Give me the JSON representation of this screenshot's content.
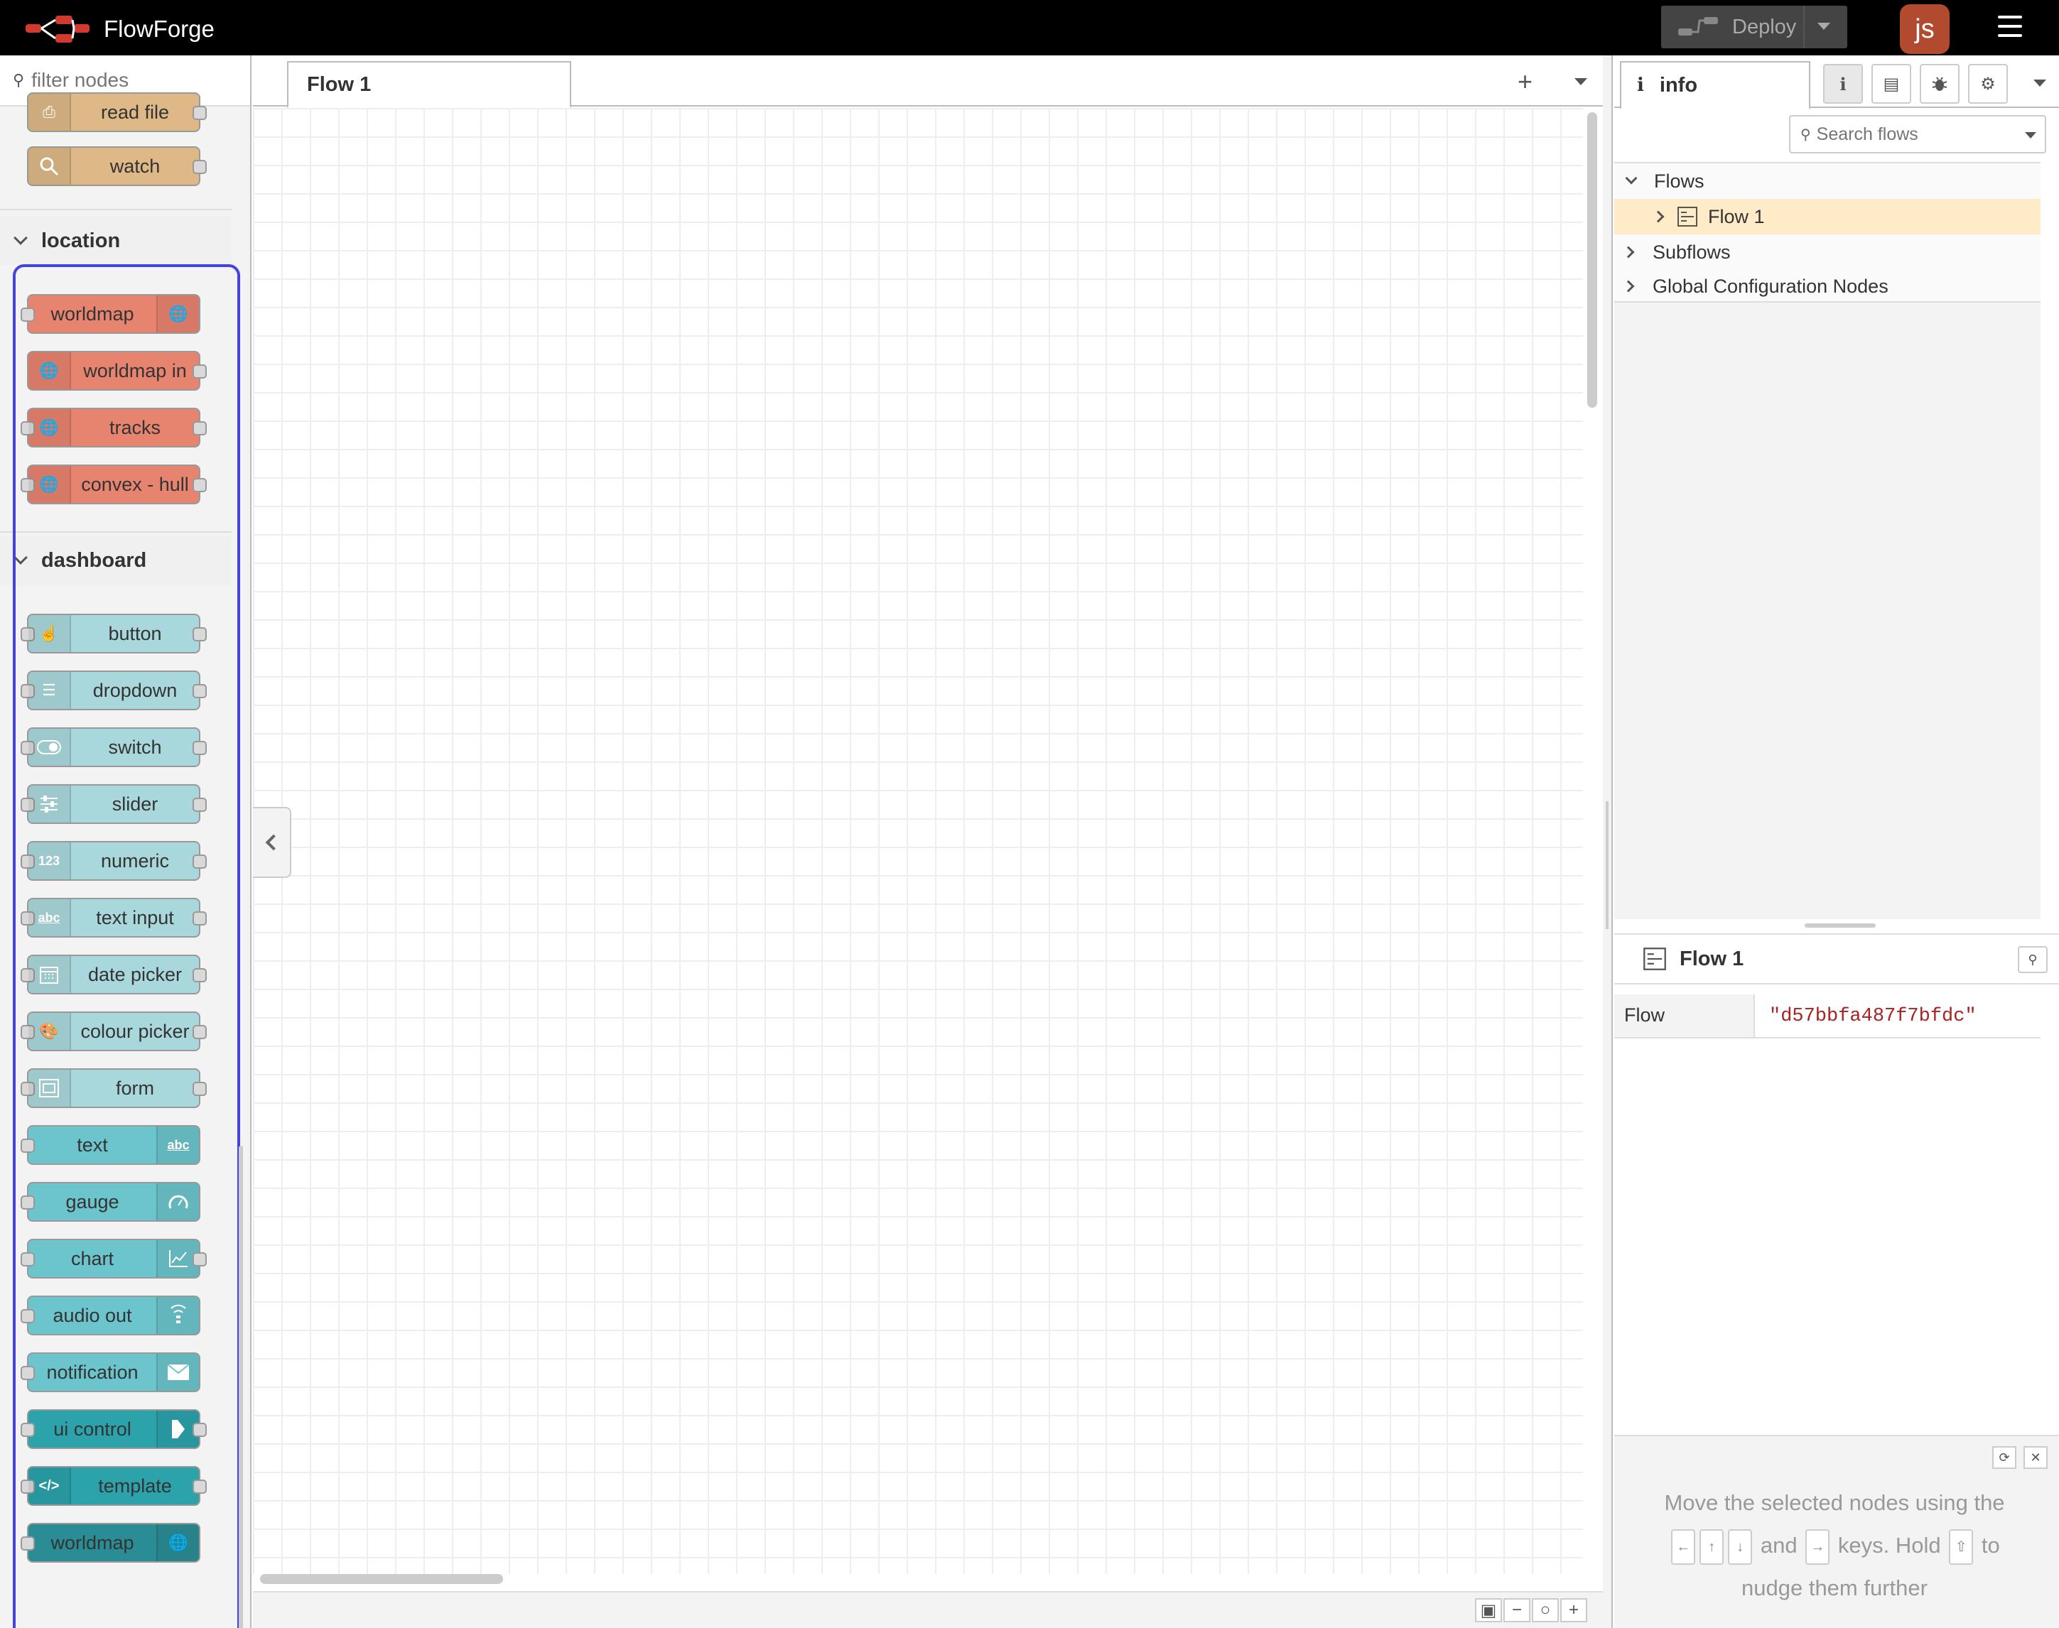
{
  "app": {
    "title": "FlowForge",
    "user_initials": "js"
  },
  "deploy": {
    "label": "Deploy"
  },
  "palette": {
    "filter_placeholder": "filter nodes",
    "top_nodes": [
      {
        "label": "read file",
        "color": "#DEB887"
      },
      {
        "label": "watch",
        "color": "#DEB887"
      }
    ],
    "categories": [
      {
        "name": "location",
        "nodes": [
          {
            "label": "worldmap",
            "icon": "globe-icon",
            "color": "#E7846F"
          },
          {
            "label": "worldmap in",
            "icon": "globe-icon",
            "color": "#E7846F"
          },
          {
            "label": "tracks",
            "icon": "globe-icon",
            "color": "#E7846F"
          },
          {
            "label": "convex - hull",
            "icon": "globe-icon",
            "color": "#E7846F"
          }
        ]
      },
      {
        "name": "dashboard",
        "nodes": [
          {
            "label": "button",
            "icon": "hand-pointer-icon",
            "color": "#A9D8DC"
          },
          {
            "label": "dropdown",
            "icon": "list-icon",
            "color": "#A9D8DC"
          },
          {
            "label": "switch",
            "icon": "toggle-icon",
            "color": "#A9D8DC"
          },
          {
            "label": "slider",
            "icon": "sliders-icon",
            "color": "#A9D8DC"
          },
          {
            "label": "numeric",
            "icon": "numeric-icon",
            "color": "#A9D8DC"
          },
          {
            "label": "text input",
            "icon": "text-abc-icon",
            "color": "#A9D8DC"
          },
          {
            "label": "date picker",
            "icon": "calendar-icon",
            "color": "#A9D8DC"
          },
          {
            "label": "colour picker",
            "icon": "palette-icon",
            "color": "#A9D8DC"
          },
          {
            "label": "form",
            "icon": "form-icon",
            "color": "#A9D8DC"
          },
          {
            "label": "text",
            "icon": "text-abc-icon",
            "color": "#6CC4CC"
          },
          {
            "label": "gauge",
            "icon": "gauge-icon",
            "color": "#6CC4CC"
          },
          {
            "label": "chart",
            "icon": "chart-line-icon",
            "color": "#6CC4CC"
          },
          {
            "label": "audio out",
            "icon": "audio-icon",
            "color": "#6CC4CC"
          },
          {
            "label": "notification",
            "icon": "envelope-icon",
            "color": "#6CC4CC"
          },
          {
            "label": "ui control",
            "icon": "arrow-right-icon",
            "color": "#2CA2AB"
          },
          {
            "label": "template",
            "icon": "code-icon",
            "color": "#2CA2AB"
          },
          {
            "label": "worldmap",
            "icon": "globe-icon",
            "color": "#2A8C95"
          }
        ]
      }
    ]
  },
  "workspace": {
    "tabs": [
      {
        "label": "Flow 1"
      }
    ]
  },
  "sidebar": {
    "active_tab": "info",
    "search_placeholder": "Search flows",
    "tree": {
      "flows_label": "Flows",
      "flow_item": "Flow 1",
      "subflows_label": "Subflows",
      "global_config_label": "Global Configuration Nodes"
    },
    "detail": {
      "title": "Flow 1",
      "properties": [
        {
          "key": "Flow",
          "value": "\"d57bbfa487f7bfdc\""
        }
      ]
    },
    "hint": {
      "line1": "Move the selected nodes using the",
      "and": "and",
      "keys_hold": "keys. Hold",
      "to": "to",
      "line3": "nudge them further",
      "key_left": "←",
      "key_up": "↑",
      "key_down": "↓",
      "key_right": "→",
      "key_shift": "⇧"
    }
  }
}
